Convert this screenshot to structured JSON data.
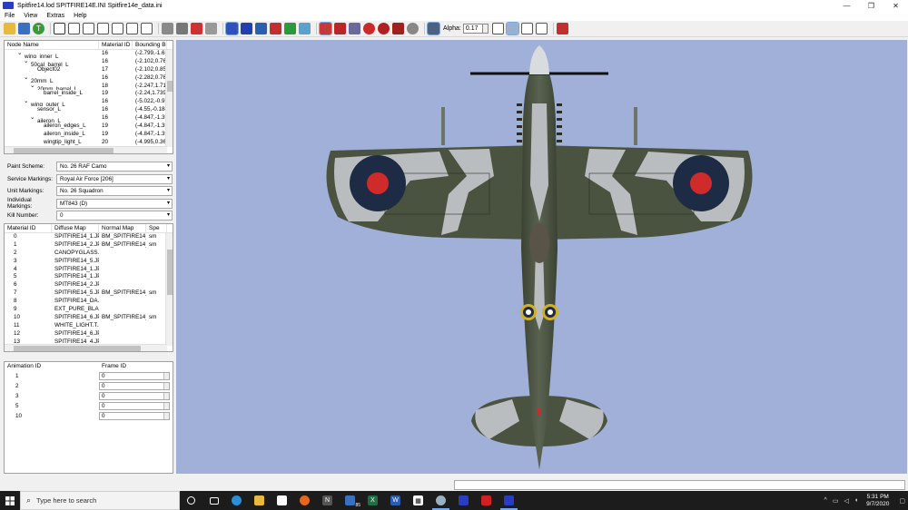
{
  "window": {
    "title": "Spitfire14.lod  SPITFIRE14E.INI  Spitfire14e_data.ini",
    "minimize": "—",
    "maximize": "❐",
    "close": "✕"
  },
  "menu": [
    "File",
    "View",
    "Extras",
    "Help"
  ],
  "toolbar": {
    "alpha_label": "Alpha:",
    "alpha_value": "0.17"
  },
  "node_tree": {
    "columns": [
      "Node Name",
      "Material ID",
      "Bounding B"
    ],
    "rows": [
      {
        "indent": 2,
        "toggle": "⌄",
        "name": "wing_inner_L",
        "material": "16",
        "bounds": "(-2.799,-1.62"
      },
      {
        "indent": 3,
        "toggle": "⌄",
        "name": "50cal_barrel_L",
        "material": "16",
        "bounds": "(-2.102,0.767"
      },
      {
        "indent": 4,
        "toggle": "",
        "name": "Object02",
        "material": "17",
        "bounds": "(-2.102,0.857"
      },
      {
        "indent": 3,
        "toggle": "⌄",
        "name": "20mm_L",
        "material": "16",
        "bounds": "(-2.282,0.767"
      },
      {
        "indent": 4,
        "toggle": "⌄",
        "name": "20mm_barrel_L",
        "material": "18",
        "bounds": "(-2.247,1.719"
      },
      {
        "indent": 5,
        "toggle": "",
        "name": "barrel_inside_L",
        "material": "19",
        "bounds": "(-2.24,1.739,"
      },
      {
        "indent": 3,
        "toggle": "⌄",
        "name": "wing_outer_L",
        "material": "16",
        "bounds": "(-5.022,-0.97"
      },
      {
        "indent": 4,
        "toggle": "",
        "name": "sensor_L",
        "material": "16",
        "bounds": "(-4.55,-0.184"
      },
      {
        "indent": 4,
        "toggle": "⌄",
        "name": "aileron_L",
        "material": "16",
        "bounds": "(-4.847,-1.39"
      },
      {
        "indent": 5,
        "toggle": "",
        "name": "aileron_edges_L",
        "material": "19",
        "bounds": "(-4.847,-1.39"
      },
      {
        "indent": 5,
        "toggle": "",
        "name": "aileron_inside_L",
        "material": "19",
        "bounds": "(-4.847,-1.39"
      },
      {
        "indent": 5,
        "toggle": "",
        "name": "wingtip_light_L",
        "material": "20",
        "bounds": "(-4.995,0.368"
      }
    ]
  },
  "properties": [
    {
      "label": "Paint Scheme:",
      "value": "No. 26 RAF Camo"
    },
    {
      "label": "Service Markings:",
      "value": "Royal Air Force [206]"
    },
    {
      "label": "Unit Markings:",
      "value": "No. 26 Squadron"
    },
    {
      "label": "Individual Markings:",
      "value": "MT843 (D)"
    },
    {
      "label": "Kill Number:",
      "value": "0"
    }
  ],
  "materials": {
    "columns": [
      "Material ID",
      "Diffuse Map",
      "Normal Map",
      "Spe"
    ],
    "rows": [
      {
        "id": "0",
        "diffuse": "SPITFIRE14_1.JPG",
        "normal": "BM_SPITFIRE14_...",
        "spec": "sm"
      },
      {
        "id": "1",
        "diffuse": "SPITFIRE14_2.JPG",
        "normal": "BM_SPITFIRE14_...",
        "spec": "sm"
      },
      {
        "id": "2",
        "diffuse": "CANOPYGLASS...",
        "normal": "",
        "spec": ""
      },
      {
        "id": "3",
        "diffuse": "SPITFIRE14_5.JPG",
        "normal": "",
        "spec": ""
      },
      {
        "id": "4",
        "diffuse": "SPITFIRE14_1.JPG",
        "normal": "",
        "spec": ""
      },
      {
        "id": "5",
        "diffuse": "SPITFIRE14_1.JPG",
        "normal": "",
        "spec": ""
      },
      {
        "id": "6",
        "diffuse": "SPITFIRE14_2.JPG",
        "normal": "",
        "spec": ""
      },
      {
        "id": "7",
        "diffuse": "SPITFIRE14_5.JPG",
        "normal": "BM_SPITFIRE14_...",
        "spec": "sm"
      },
      {
        "id": "8",
        "diffuse": "SPITFIRE14_DA...",
        "normal": "",
        "spec": ""
      },
      {
        "id": "9",
        "diffuse": "EXT_PURE_BLA...",
        "normal": "",
        "spec": ""
      },
      {
        "id": "10",
        "diffuse": "SPITFIRE14_6.JPG",
        "normal": "BM_SPITFIRE14_...",
        "spec": "sm"
      },
      {
        "id": "11",
        "diffuse": "WHITE_LIGHT.T...",
        "normal": "",
        "spec": ""
      },
      {
        "id": "12",
        "diffuse": "SPITFIRE14_6.JPG",
        "normal": "",
        "spec": ""
      },
      {
        "id": "13",
        "diffuse": "SPITFIRE14_4.JPG",
        "normal": "",
        "spec": ""
      }
    ]
  },
  "animations": {
    "columns": [
      "Animation ID",
      "Frame ID"
    ],
    "rows": [
      {
        "id": "1",
        "frame": "0"
      },
      {
        "id": "2",
        "frame": "0"
      },
      {
        "id": "3",
        "frame": "0"
      },
      {
        "id": "5",
        "frame": "0"
      },
      {
        "id": "10",
        "frame": "0"
      }
    ]
  },
  "taskbar": {
    "search_placeholder": "Type here to search",
    "time": "5:31 PM",
    "date": "9/7/2020",
    "mail_badge": "85",
    "pinned": [
      "task-view",
      "edge",
      "file-explorer",
      "store",
      "firefox",
      "notion",
      "mail",
      "excel",
      "word",
      "photos",
      "app",
      "lod-viewer",
      "acrobat",
      "lod-viewer-2"
    ]
  },
  "colors": {
    "viewport_bg": "#a0b0d8",
    "camo_grey": "#4a5240",
    "camo_light": "#b9bdbf",
    "roundel_blue": "#1e2b45",
    "roundel_red": "#d02b2b"
  }
}
